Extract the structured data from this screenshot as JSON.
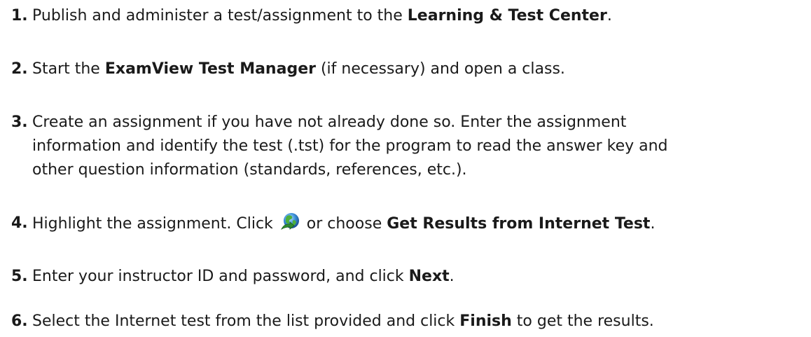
{
  "steps": [
    {
      "number": "1.",
      "t1": "Publish and administer a test/assignment to the ",
      "b1": "Learning & Test Center",
      "t2": "."
    },
    {
      "number": "2.",
      "t1": "Start the ",
      "b1": "ExamView Test Manager",
      "t2": " (if necessary) and open a class."
    },
    {
      "number": "3.",
      "line1": "Create an assignment if you have not already done so. Enter the assignment",
      "line2": "information and identify the test (.tst) for the program to read the answer key and",
      "line3": "other question information (standards, references, etc.)."
    },
    {
      "number": "4.",
      "t1": "Highlight the assignment. Click ",
      "icon": "get-internet-results-globe-icon",
      "t2": " or choose ",
      "b1": "Get Results from Internet Test",
      "t3": "."
    },
    {
      "number": "5.",
      "t1": "Enter your instructor ID and password, and click ",
      "b1": "Next",
      "t2": "."
    },
    {
      "number": "6.",
      "t1": "Select the Internet test from the list provided and click ",
      "b1": "Finish",
      "t2": " to get the results."
    }
  ]
}
